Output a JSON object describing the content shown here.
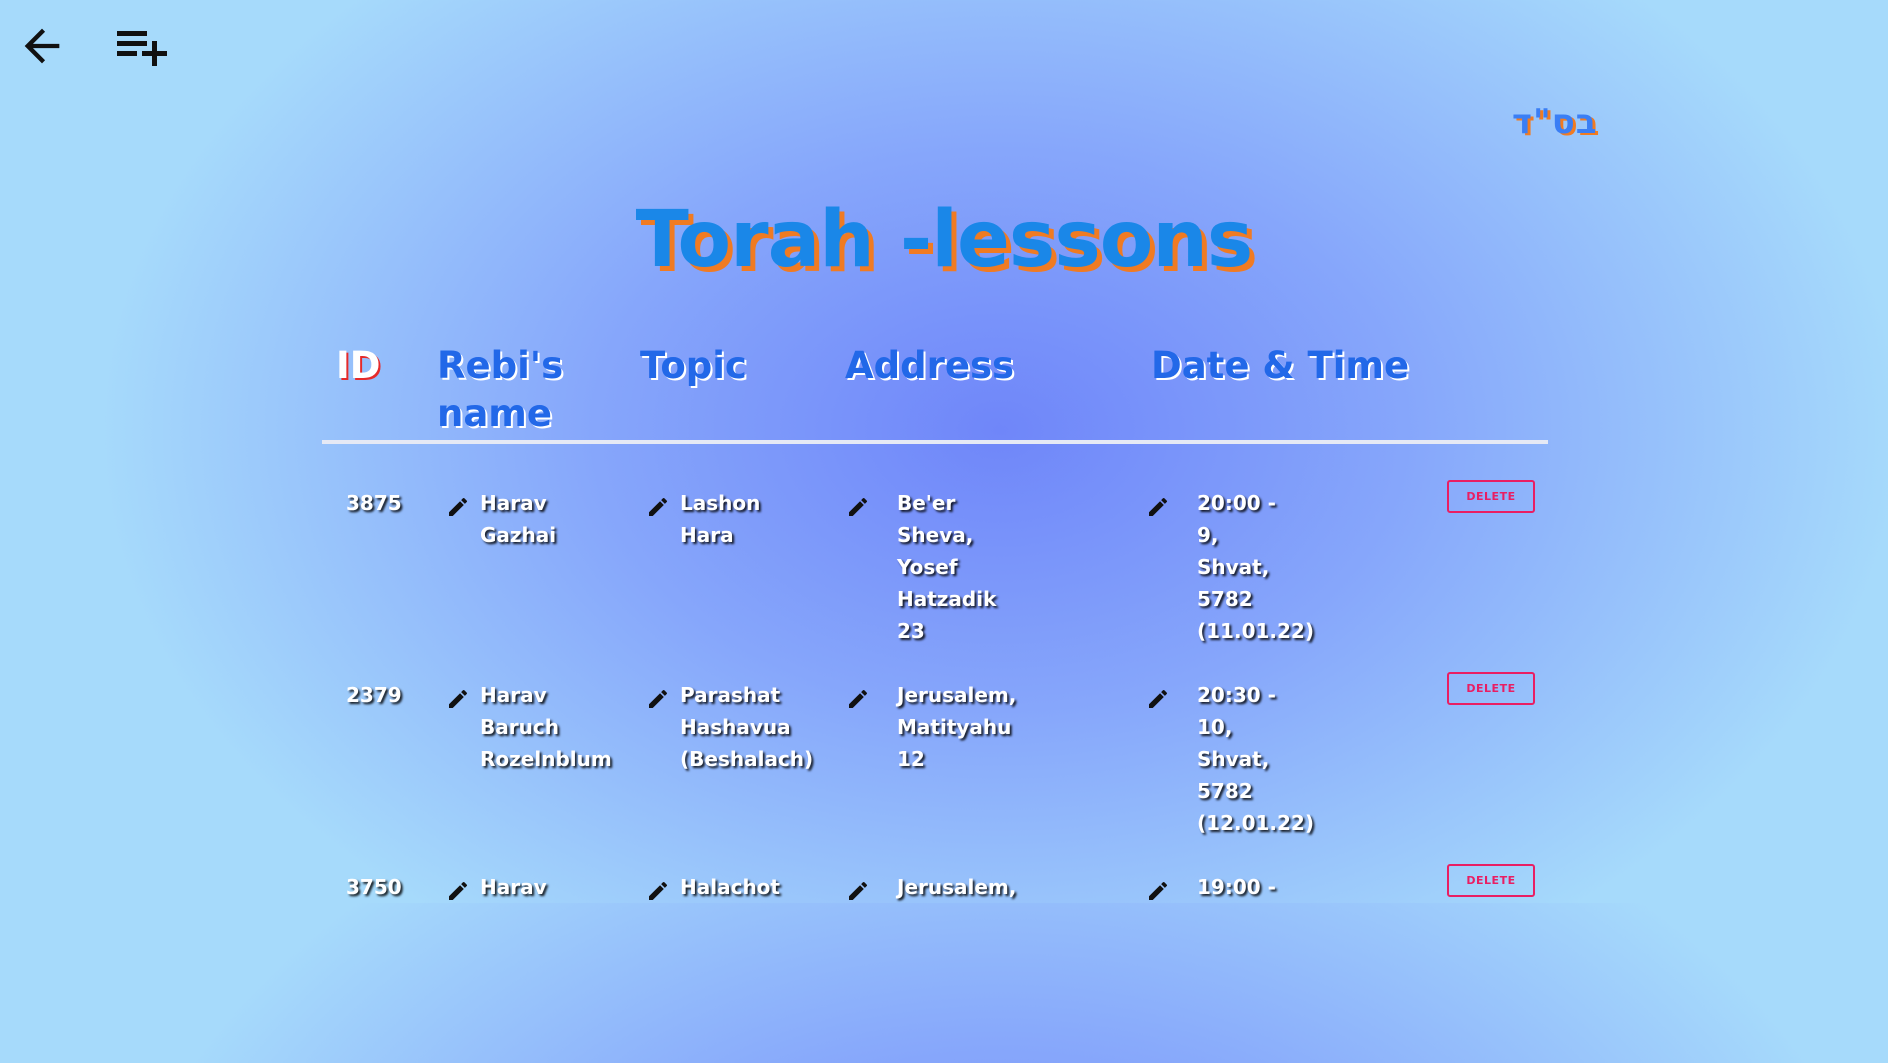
{
  "header": {
    "back_icon": "arrow-left-icon",
    "add_icon": "playlist-add-icon",
    "bsd": "בס\"ד",
    "title": "Torah -lessons"
  },
  "table": {
    "columns": {
      "id": "ID",
      "name": "Rebi's name",
      "topic": "Topic",
      "address": "Address",
      "datetime": "Date & Time"
    },
    "delete_label": "DELETE",
    "rows": [
      {
        "id": "3875",
        "name": "Harav Gazhai",
        "topic": "Lashon Hara",
        "address": "Be'er Sheva, Yosef Hatzadik 23",
        "datetime": "20:00 - 9, Shvat, 5782 (11.01.22)"
      },
      {
        "id": "2379",
        "name": "Harav Baruch Rozelnblum",
        "topic": "Parashat Hashavua (Beshalach)",
        "address": "Jerusalem, Matityahu 12",
        "datetime": "20:30 - 10, Shvat, 5782 (12.01.22)"
      },
      {
        "id": "3750",
        "name": "Harav",
        "topic": "Halachot",
        "address": "Jerusalem,",
        "datetime": "19:00 -"
      }
    ]
  },
  "colors": {
    "title": "#1a87e8",
    "title_shadow": "#f07b22",
    "header_text": "#2268e8",
    "delete": "#e91e63"
  }
}
